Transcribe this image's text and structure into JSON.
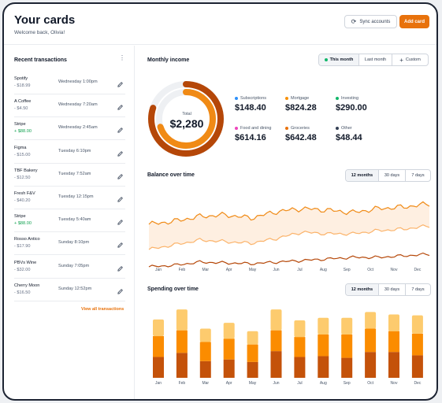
{
  "header": {
    "title": "Your cards",
    "subtitle": "Welcome back, Olivia!",
    "sync_label": "Sync accounts",
    "add_label": "Add card"
  },
  "transactions": {
    "title": "Recent transactions",
    "view_all": "View all transactions",
    "items": [
      {
        "name": "Spotify",
        "amount": "- $18.99",
        "date": "Wednesday 1:00pm",
        "positive": false
      },
      {
        "name": "A Coffee",
        "amount": "- $4.50",
        "date": "Wednesday 7:20am",
        "positive": false
      },
      {
        "name": "Stripe",
        "amount": "+ $88.00",
        "date": "Wednesday 2:45am",
        "positive": true
      },
      {
        "name": "Figma",
        "amount": "- $15.00",
        "date": "Tuesday 6:10pm",
        "positive": false
      },
      {
        "name": "TBF Bakery",
        "amount": "- $12.50",
        "date": "Tuesday 7:52am",
        "positive": false
      },
      {
        "name": "Fresh F&V",
        "amount": "- $40.20",
        "date": "Tuesday 12:15pm",
        "positive": false
      },
      {
        "name": "Stripe",
        "amount": "+ $88.00",
        "date": "Tuesday 5:40am",
        "positive": true
      },
      {
        "name": "Rosso Antico",
        "amount": "- $17.90",
        "date": "Sunday 8:10pm",
        "positive": false
      },
      {
        "name": "PBVs Wine",
        "amount": "- $32.00",
        "date": "Sunday 7:05pm",
        "positive": false
      },
      {
        "name": "Cherry Moon",
        "amount": "- $16.50",
        "date": "Sunday 12:52pm",
        "positive": false
      }
    ]
  },
  "income": {
    "title": "Monthly income",
    "filters": [
      "This month",
      "Last month",
      "Custom"
    ],
    "active_filter": "This month",
    "total_label": "Total",
    "total_value": "$2,280",
    "categories": [
      {
        "label": "Subscriptions",
        "value": "$148.40",
        "color": "#2e90fa"
      },
      {
        "label": "Mortgage",
        "value": "$824.28",
        "color": "#f79009"
      },
      {
        "label": "Investing",
        "value": "$290.00",
        "color": "#12b76a"
      },
      {
        "label": "Food and dining",
        "value": "$614.16",
        "color": "#ee46bc"
      },
      {
        "label": "Groceries",
        "value": "$642.48",
        "color": "#e8720c"
      },
      {
        "label": "Other",
        "value": "$48.44",
        "color": "#344054"
      }
    ],
    "ring_fill": {
      "outer": 0.8,
      "inner": 0.7
    }
  },
  "balance": {
    "title": "Balance over time",
    "filters": [
      "12 months",
      "30 days",
      "7 days"
    ],
    "active_filter": "12 months",
    "months": [
      "Jan",
      "Feb",
      "Mar",
      "Apr",
      "May",
      "Jun",
      "Jul",
      "Aug",
      "Sep",
      "Oct",
      "Nov",
      "Dec"
    ]
  },
  "spending": {
    "title": "Spending over time",
    "filters": [
      "12 months",
      "30 days",
      "7 days"
    ],
    "active_filter": "12 months",
    "months": [
      "Jan",
      "Feb",
      "Mar",
      "Apr",
      "May",
      "Jun",
      "Jul",
      "Aug",
      "Sep",
      "Oct",
      "Nov",
      "Dec"
    ]
  },
  "chart_data": [
    {
      "type": "line",
      "title": "Balance over time",
      "categories": [
        "Jan",
        "Feb",
        "Mar",
        "Apr",
        "May",
        "Jun",
        "Jul",
        "Aug",
        "Sep",
        "Oct",
        "Nov",
        "Dec"
      ],
      "series": [
        {
          "values": [
            62,
            66,
            72,
            74,
            70,
            78,
            82,
            80,
            77,
            82,
            84,
            88
          ]
        },
        {
          "values": [
            30,
            36,
            42,
            40,
            38,
            44,
            52,
            50,
            50,
            54,
            56,
            60
          ]
        },
        {
          "values": [
            8,
            10,
            14,
            13,
            12,
            14,
            16,
            18,
            20,
            20,
            22,
            24
          ]
        }
      ],
      "ylim": [
        0,
        100
      ]
    },
    {
      "type": "bar",
      "title": "Spending over time",
      "categories": [
        "Jan",
        "Feb",
        "Mar",
        "Apr",
        "May",
        "Jun",
        "Jul",
        "Aug",
        "Sep",
        "Oct",
        "Nov",
        "Dec"
      ],
      "series": [
        {
          "values": [
            25,
            30,
            20,
            22,
            19,
            32,
            25,
            26,
            24,
            31,
            31,
            27
          ]
        },
        {
          "values": [
            25,
            27,
            23,
            25,
            21,
            25,
            24,
            26,
            28,
            28,
            25,
            26
          ]
        },
        {
          "values": [
            20,
            25,
            16,
            19,
            16,
            25,
            20,
            20,
            20,
            20,
            20,
            22
          ]
        }
      ],
      "colors": [
        "#c4520a",
        "#fb8c00",
        "#fdcb6e"
      ],
      "ylim": [
        0,
        85
      ]
    }
  ]
}
